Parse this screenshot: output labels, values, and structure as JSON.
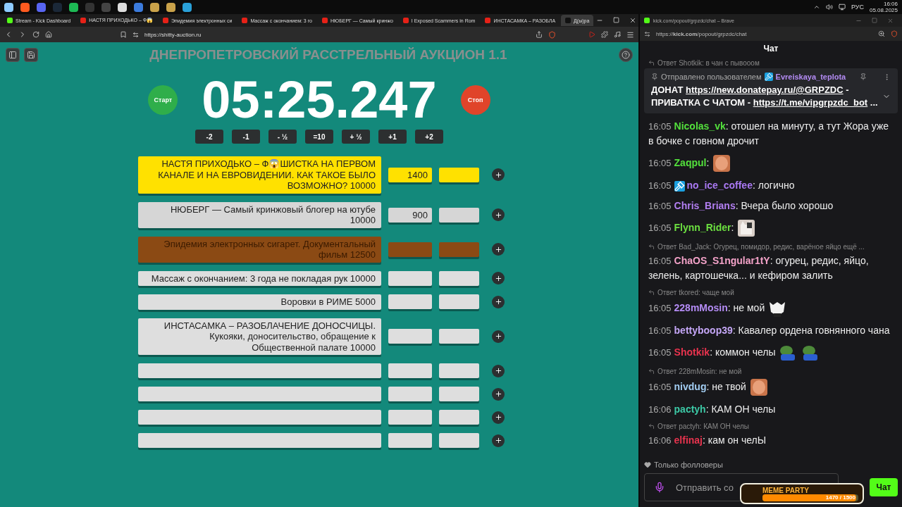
{
  "taskbar": {
    "language": "РУС",
    "time": "16:06",
    "date": "05.08.2025"
  },
  "browser": {
    "tabs": [
      {
        "title": "Stream - Kick Dashboard",
        "kind": "kick",
        "selected": false
      },
      {
        "title": "НАСТЯ ПРИХОДЬКО – Ф😱",
        "kind": "video",
        "selected": false
      },
      {
        "title": "Эпидемия электронных си",
        "kind": "video",
        "selected": false
      },
      {
        "title": "Массаж с окончанием: 3 го",
        "kind": "video",
        "selected": false
      },
      {
        "title": "НЮБЕРГ — Самый кринжо",
        "kind": "video",
        "selected": false
      },
      {
        "title": "I Exposed Scammers in Rom",
        "kind": "video",
        "selected": false
      },
      {
        "title": "ИНСТАСАМКА – РАЗОБЛА",
        "kind": "video",
        "selected": false
      },
      {
        "title": "Д(ы)ра",
        "kind": "site",
        "selected": true
      }
    ],
    "url": "https://shitty-auction.ru"
  },
  "auction": {
    "title": "ДНЕПРОПЕТРОВСКИЙ РАССТРЕЛЬНЫЙ АУКЦИОН 1.1",
    "start": "Старт",
    "timer": "05:25.247",
    "stop": "Стоп",
    "steps": [
      "-2",
      "-1",
      "- ½",
      "=10",
      "+ ½",
      "+1",
      "+2"
    ],
    "lots": [
      {
        "name": "НАСТЯ ПРИХОДЬКО – Ф😱ШИСТКА НА ПЕРВОМ КАНАЛЕ И НА ЕВРОВИДЕНИИ. КАК ТАКОЕ БЫЛО ВОЗМОЖНО? 10000",
        "bid": "1400",
        "color": "#ffe100"
      },
      {
        "name": "НЮБЕРГ — Самый кринжовый блогер на ютубе 10000",
        "bid": "900",
        "color": "#d6d6d6"
      },
      {
        "name": "Эпидемия электронных сигарет. Документальный фильм 12500",
        "color": "#8b4a14"
      },
      {
        "name": "Массаж с окончанием: 3 года не покладая рук 10000",
        "color": "#dedede"
      },
      {
        "name": "Воровки в РИМЕ 5000",
        "color": "#dedede"
      },
      {
        "name": "ИНСТАСАМКА – РАЗОБЛАЧЕНИЕ ДОНОСЧИЦЫ. Кукояки, доносительство, обращение к Общественной палате 10000",
        "color": "#dedede"
      },
      {
        "color": "#dedede"
      },
      {
        "color": "#dedede"
      },
      {
        "color": "#dedede"
      },
      {
        "color": "#dedede"
      }
    ]
  },
  "chat_window": {
    "title": "kick.com/popout/grpzdc/chat – Brave",
    "url": "https://**kick.com**/popout/grpzdc/chat",
    "header": "Чат",
    "top_reply": "Ответ Shotkik: в чан с пывооом",
    "pinned": {
      "label": "Отправлено пользователем",
      "user": "Evreiskaya_teplota",
      "parts": [
        {
          "text": "ДОНАТ ",
          "link": false
        },
        {
          "text": "https://new.donatepay.ru/@GRPZDC",
          "link": true
        },
        {
          "text": " - ПРИВАТКА С ЧАТОМ - ",
          "link": false
        },
        {
          "text": "https://t.me/vipgrpzdc_bot",
          "link": true
        },
        {
          "text": " ...",
          "link": false
        }
      ]
    },
    "messages": [
      {
        "time": "16:05",
        "user": "Nicolas_vk",
        "color": "#53e03c",
        "moderator": false,
        "text": ": отошел на минуту, а тут Жора уже в бочке с говном дрочит"
      },
      {
        "time": "16:05",
        "user": "Zaqpul",
        "color": "#53e03c",
        "moderator": false,
        "text": ":",
        "emotes": [
          {
            "kind": "face"
          }
        ]
      },
      {
        "time": "16:05",
        "user": "no_ice_coffee",
        "color": "#a978f2",
        "moderator": true,
        "text": ": логично"
      },
      {
        "time": "16:05",
        "user": "Chris_Brians",
        "color": "#b37ff2",
        "moderator": false,
        "text": ": Вчера было хорошо"
      },
      {
        "time": "16:05",
        "user": "Flynn_Rider",
        "color": "#6ce040",
        "moderator": false,
        "text": ":",
        "emotes": [
          {
            "kind": "cat"
          }
        ]
      },
      {
        "reply": "Ответ Bad_Jack: Огурец, помидор, редис, варёное яйцо ещё ...",
        "time": "16:05",
        "user": "ChaOS_S1ngular1tY",
        "color": "#f3a2c8",
        "moderator": false,
        "text": ": огурец, редис, яйцо, зелень, картошечка... и кефиром залить"
      },
      {
        "reply": "Ответ tkored: чаще мой",
        "time": "16:05",
        "user": "228mMosin",
        "color": "#b48cf5",
        "moderator": false,
        "text": ": не мой",
        "emotes": [
          {
            "kind": "mask"
          }
        ]
      },
      {
        "time": "16:05",
        "user": "bettyboop39",
        "color": "#c4a6f6",
        "moderator": false,
        "text": ": Кавалер ордена говнянного чана"
      },
      {
        "time": "16:05",
        "user": "Shotkik",
        "color": "#e8334e",
        "moderator": false,
        "text": ": коммон челы",
        "emotes": [
          {
            "kind": "frog"
          },
          {
            "kind": "frog"
          }
        ]
      },
      {
        "reply": "Ответ 228mMosin: не мой",
        "time": "16:05",
        "user": "nivdug",
        "color": "#a2cdf2",
        "moderator": false,
        "text": ": не твой",
        "emotes": [
          {
            "kind": "face"
          }
        ]
      },
      {
        "time": "16:06",
        "user": "pactyh",
        "color": "#3cc9a6",
        "moderator": false,
        "text": ": КАМ ОН челы"
      },
      {
        "reply": "Ответ pactyh: КАМ ОН челы",
        "time": "16:06",
        "user": "elfinaj",
        "color": "#e8334e",
        "moderator": false,
        "text": ": кам он челЫ"
      }
    ],
    "followers_only": "Только фолловеры",
    "input": {
      "placeholder": "Отправить со"
    },
    "send": "Чат",
    "overlay": {
      "title": "MEME PARTY",
      "progress": "1470 / 1500",
      "level": 0.98
    }
  }
}
